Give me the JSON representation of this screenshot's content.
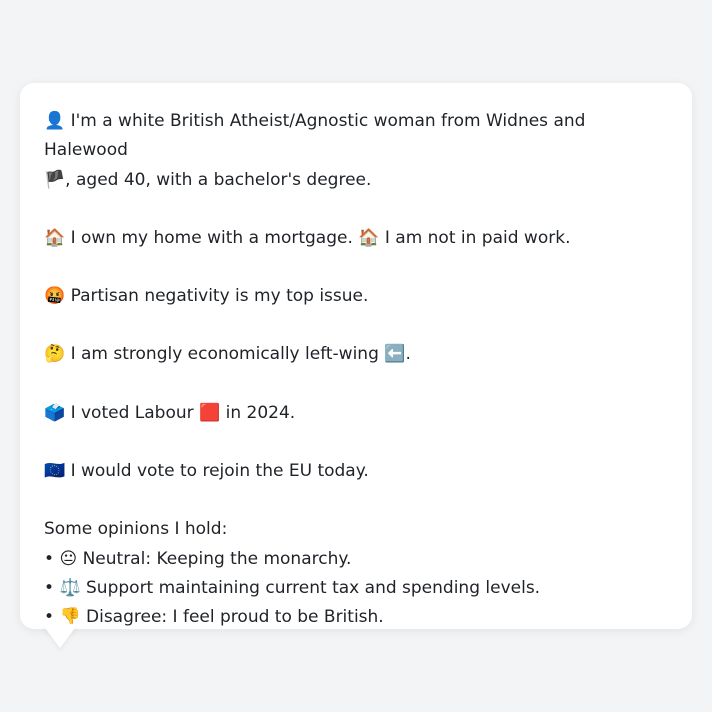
{
  "profile": {
    "identity_emoji": "👤",
    "identity_text": "I'm a white British Atheist/Agnostic woman from Widnes and Halewood",
    "identity_flag": "🏴",
    "identity_rest": ", aged 40, with a bachelor's degree.",
    "home_emoji": "🏠",
    "home_text": "I own my home with a mortgage.",
    "work_emoji": "🏠",
    "work_text": "I am not in paid work.",
    "issue_emoji": "🤬",
    "issue_text": "Partisan negativity is my top issue.",
    "econ_emoji": "🤔",
    "econ_text": "I am strongly economically left-wing",
    "econ_arrow": "⬅️",
    "econ_end": ".",
    "vote_emoji": "🗳️",
    "vote_text": "I voted Labour",
    "vote_party_emoji": "🟥",
    "vote_end": "in 2024.",
    "eu_emoji": "🇪🇺",
    "eu_text": "I would vote to rejoin the EU today."
  },
  "opinions": {
    "heading": "Some opinions I hold:",
    "bullet": "•",
    "items": [
      {
        "emoji": "😐",
        "text": "Neutral: Keeping the monarchy."
      },
      {
        "emoji": "⚖️",
        "text": "Support maintaining current tax and spending levels."
      },
      {
        "emoji": "👎",
        "text": "Disagree: I feel proud to be British."
      }
    ]
  }
}
